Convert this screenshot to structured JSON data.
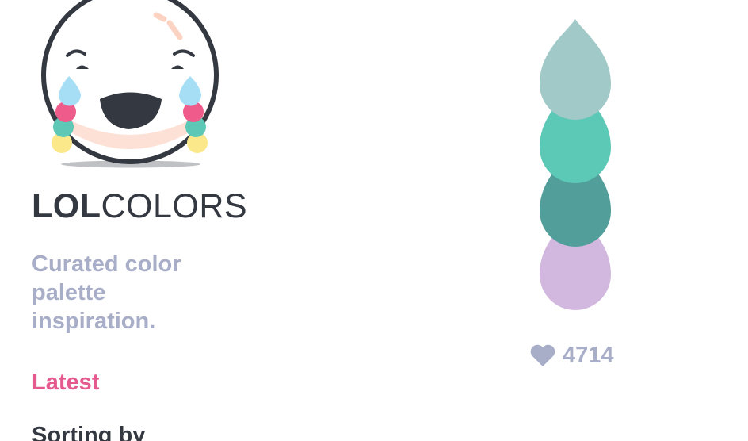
{
  "brand": {
    "name_bold": "LOL",
    "name_light": "COLORS"
  },
  "tagline": "Curated color palette inspiration.",
  "nav": {
    "latest_label": "Latest",
    "sorting_label": "Sorting by"
  },
  "palette": {
    "colors": [
      "#a0c9c7",
      "#5cc8b6",
      "#519e9a",
      "#d2b7df"
    ],
    "likes": "4714",
    "like_icon": "heart-icon"
  },
  "logo": {
    "icon": "laughing-face-logo",
    "tear_color": "#a6dff5",
    "bead_colors": [
      "#ef5b8b",
      "#5dc8b6",
      "#fbe88a"
    ]
  }
}
